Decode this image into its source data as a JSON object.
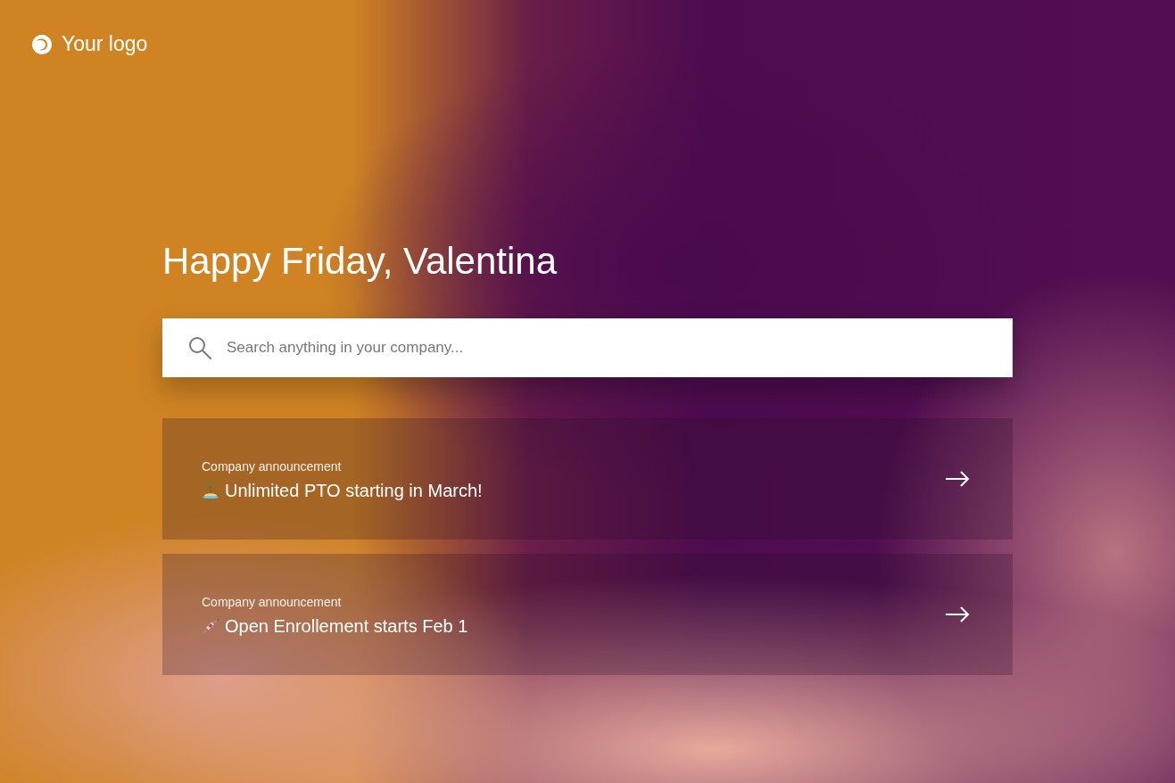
{
  "logo": {
    "text": "Your logo"
  },
  "greeting": "Happy Friday, Valentina",
  "search": {
    "placeholder": "Search anything in your company..."
  },
  "announcements": [
    {
      "kind": "island",
      "label": "Company announcement",
      "title": "Unlimited PTO starting in March!"
    },
    {
      "kind": "syringe",
      "label": "Company announcement",
      "title": "Open Enrollement starts Feb 1"
    }
  ]
}
